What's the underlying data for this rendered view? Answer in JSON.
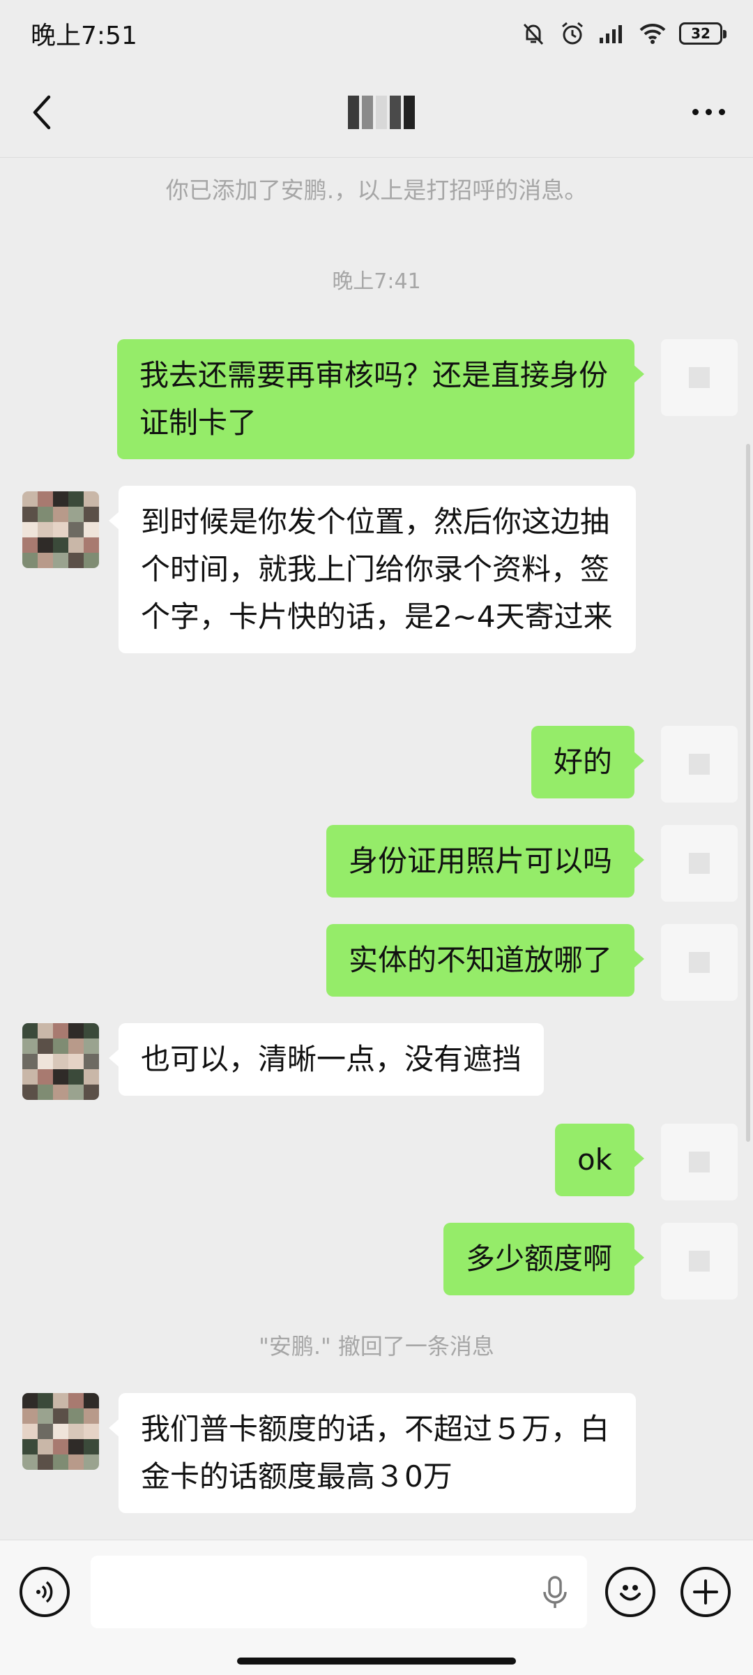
{
  "status_bar": {
    "time": "晚上7:51",
    "battery": "32",
    "icons": [
      "mute-bell-icon",
      "alarm-icon",
      "signal-icon",
      "wifi-icon",
      "battery-icon"
    ]
  },
  "nav": {
    "back_icon": "chevron-left-icon",
    "title_mosaic": [
      "#3b3b3b",
      "#8a8a8a",
      "#d8d8d8",
      "#4a4a4a",
      "#222222"
    ],
    "more_icon": "ellipsis-icon"
  },
  "chat": {
    "system_added": "你已添加了安鹏.，以上是打招呼的消息。",
    "time_divider": "晚上7:41",
    "messages": [
      {
        "side": "out",
        "text": "我去还需要再审核吗？还是直接身份证制卡了"
      },
      {
        "side": "in",
        "text": "到时候是你发个位置，然后你这边抽个时间，就我上门给你录个资料，签个字，卡片快的话，是2~4天寄过来"
      },
      {
        "side": "out",
        "text": "好的"
      },
      {
        "side": "out",
        "text": "身份证用照片可以吗"
      },
      {
        "side": "out",
        "text": "实体的不知道放哪了"
      },
      {
        "side": "in",
        "text": "也可以，清晰一点，没有遮挡"
      },
      {
        "side": "out",
        "text": "ok"
      },
      {
        "side": "out",
        "text": "多少额度啊"
      },
      {
        "side": "in",
        "text": "我们普卡额度的话，不超过５万，白金卡的话额度最高３0万"
      }
    ],
    "system_recall": "\"安鹏.\" 撤回了一条消息"
  },
  "input_bar": {
    "voice_icon": "voice-mode-icon",
    "mic_icon": "microphone-icon",
    "emoji_icon": "emoji-icon",
    "plus_icon": "plus-icon"
  },
  "colors": {
    "background": "#ededed",
    "outgoing_bubble": "#95ec69",
    "incoming_bubble": "#ffffff",
    "system_text": "#a6a6a6"
  }
}
